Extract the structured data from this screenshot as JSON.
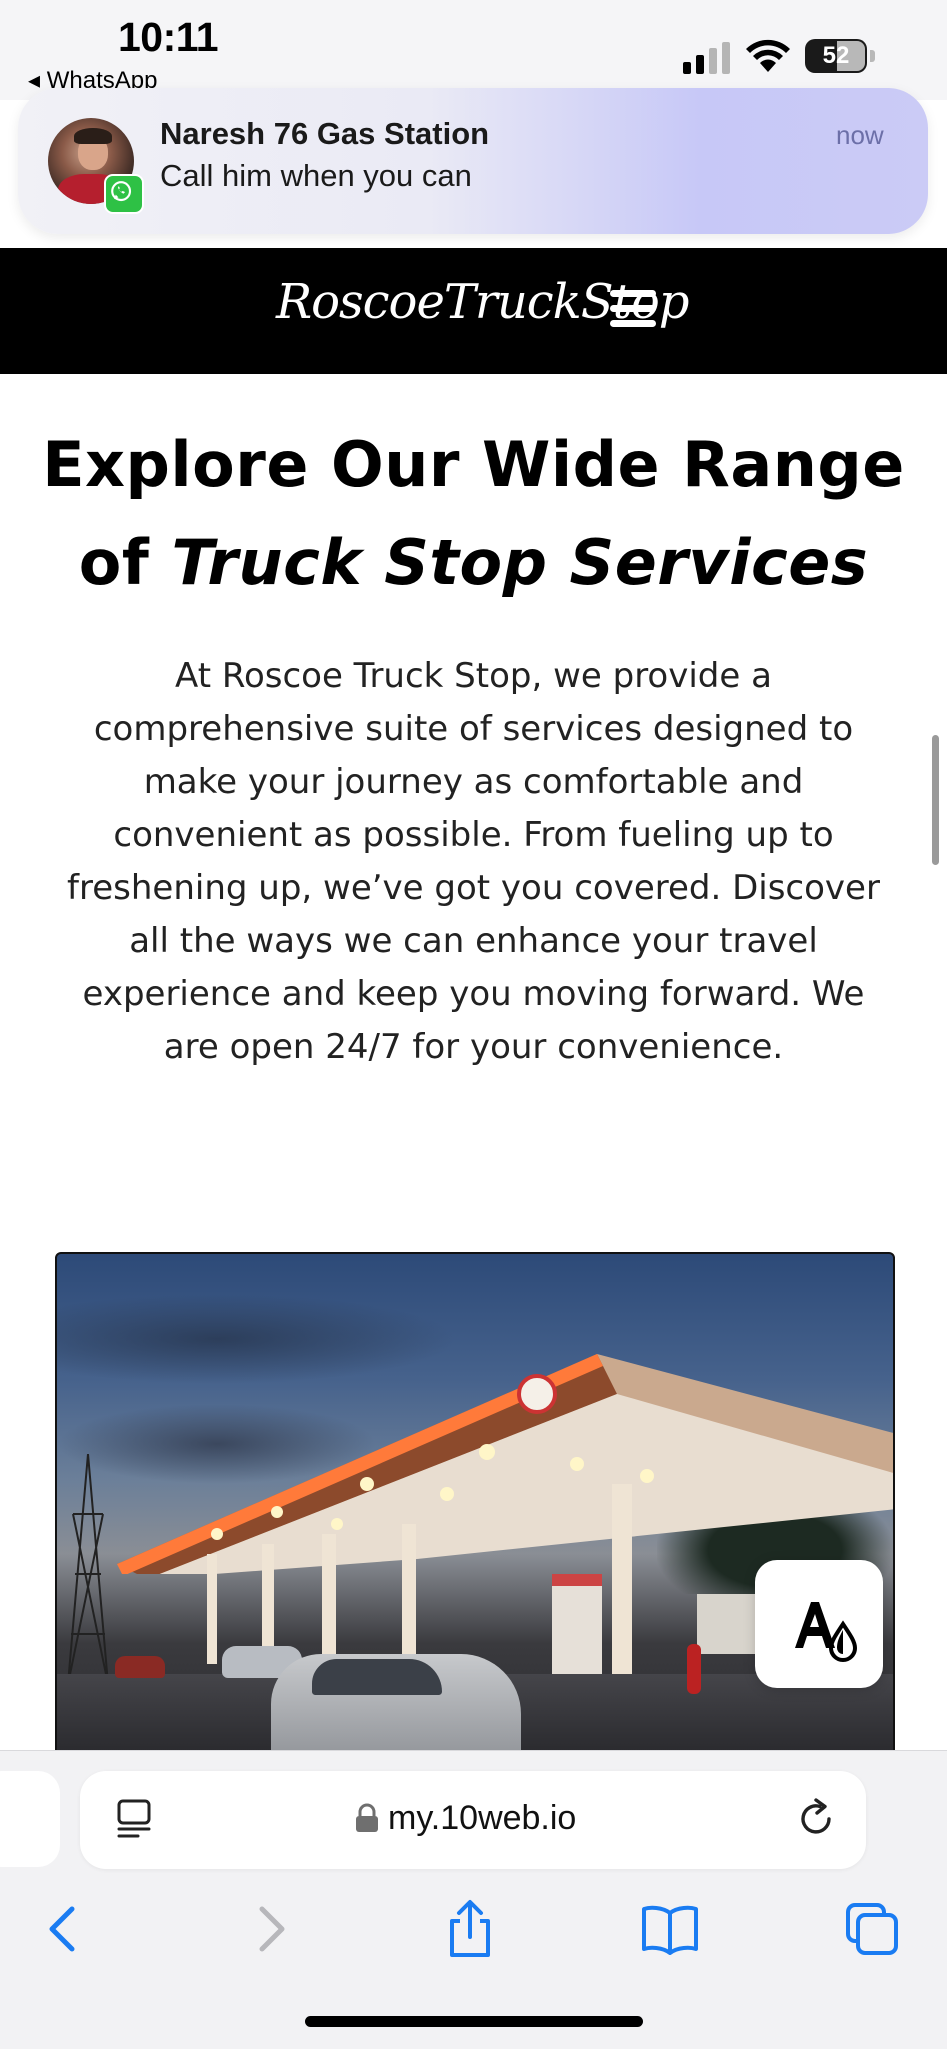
{
  "status_bar": {
    "time": "10:11",
    "back_app": "◂ WhatsApp",
    "battery": "52"
  },
  "notification": {
    "title": "Naresh 76 Gas Station",
    "body": "Call him when you can",
    "time": "now",
    "app_icon": "whatsapp-icon"
  },
  "site": {
    "logo": "RoscoeTruckStop",
    "heading_plain": "Explore Our Wide Range of",
    "heading_emph": "Truck Stop Services",
    "intro": "At Roscoe Truck Stop, we provide a comprehensive suite of services designed to make your journey as comfortable and convenient as possible. From fueling up to freshening up, we’ve got you covered. Discover all the ways we can enhance your travel experience and keep you moving forward. We are open 24/7 for your convenience."
  },
  "browser": {
    "url": "my.10web.io",
    "icons": [
      "reader-icon",
      "lock-icon",
      "reload-icon",
      "back-icon",
      "forward-icon",
      "share-icon",
      "bookmarks-icon",
      "tabs-icon"
    ]
  },
  "colors": {
    "header_bg": "#000000",
    "ios_blue": "#1a7cf2",
    "whatsapp_green": "#2ec145"
  }
}
